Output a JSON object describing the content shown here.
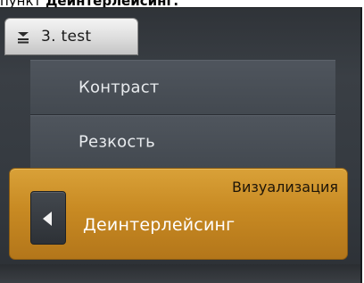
{
  "caption": {
    "prefix": "пункт ",
    "bold": "Деинтерлейсинг."
  },
  "tab": {
    "label": "3. test",
    "icon": "collapse-menu-icon"
  },
  "menu": {
    "items": [
      {
        "label": "Контраст"
      },
      {
        "label": "Резкость"
      }
    ]
  },
  "selected": {
    "category": "Визуализация",
    "value": "Деинтерлейсинг",
    "back_icon": "arrow-left-icon"
  },
  "colors": {
    "accent": "#c88a23",
    "panel": "#353a40",
    "menu_item": "#4a5057"
  }
}
